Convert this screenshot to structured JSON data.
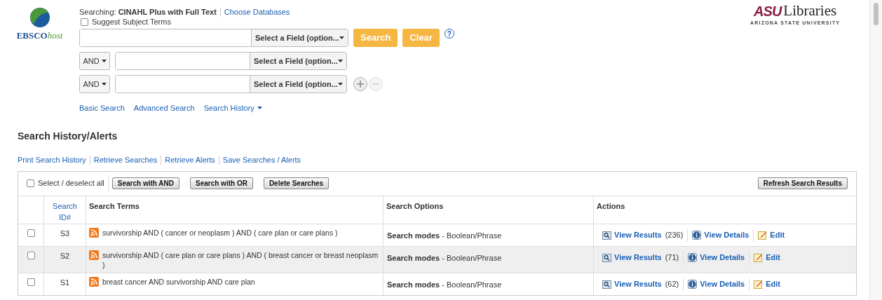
{
  "logo": {
    "text": "EBSCO",
    "suffix": "host"
  },
  "searching": {
    "label": "Searching:",
    "database": "CINAHL Plus with Full Text",
    "link": "Choose Databases"
  },
  "suggest_subject_terms": {
    "label": "Suggest Subject Terms",
    "checked": false
  },
  "search_rows": [
    {
      "operator": null,
      "field": "Select a Field (option..."
    },
    {
      "operator": "AND",
      "field": "Select a Field (option..."
    },
    {
      "operator": "AND",
      "field": "Select a Field (option..."
    }
  ],
  "buttons": [
    "Search",
    "Clear"
  ],
  "help": "?",
  "nav_links": [
    "Basic Search",
    "Advanced Search",
    "Search History"
  ],
  "brand": {
    "mark": "ASU",
    "name": "Libraries",
    "tagline": "ARIZONA STATE UNIVERSITY"
  },
  "section_title": "Search History/Alerts",
  "history_links": [
    "Print Search History",
    "Retrieve Searches",
    "Retrieve Alerts",
    "Save Searches / Alerts"
  ],
  "toolbar": {
    "select_all": {
      "label": "Select / deselect all",
      "checked": false
    },
    "buttons": [
      "Search with AND",
      "Search with OR",
      "Delete Searches"
    ],
    "refresh": "Refresh Search Results"
  },
  "table": {
    "columns": [
      "Search ID#",
      "Search Terms",
      "Search Options",
      "Actions"
    ],
    "rows": [
      {
        "checked": false,
        "highlighted": false,
        "id": "S3",
        "terms": "survivorship AND ( cancer or neoplasm ) AND ( care plan or care plans )",
        "options": "**Search modes** - Boolean/Phrase",
        "view_results": "View Results",
        "count": "(236)",
        "view_details": "View Details",
        "edit": "Edit"
      },
      {
        "checked": false,
        "highlighted": true,
        "id": "S2",
        "terms": "survivorship AND ( care plan or care plans ) AND ( breast cancer or breast neoplasm )",
        "options": "**Search modes** - Boolean/Phrase",
        "view_results": "View Results",
        "count": "(71)",
        "view_details": "View Details",
        "edit": "Edit"
      },
      {
        "checked": false,
        "highlighted": false,
        "id": "S1",
        "terms": "breast cancer AND survivorship AND care plan",
        "options": "**Search modes** - Boolean/Phrase",
        "view_results": "View Results",
        "count": "(62)",
        "view_details": "View Details",
        "edit": "Edit"
      }
    ]
  }
}
